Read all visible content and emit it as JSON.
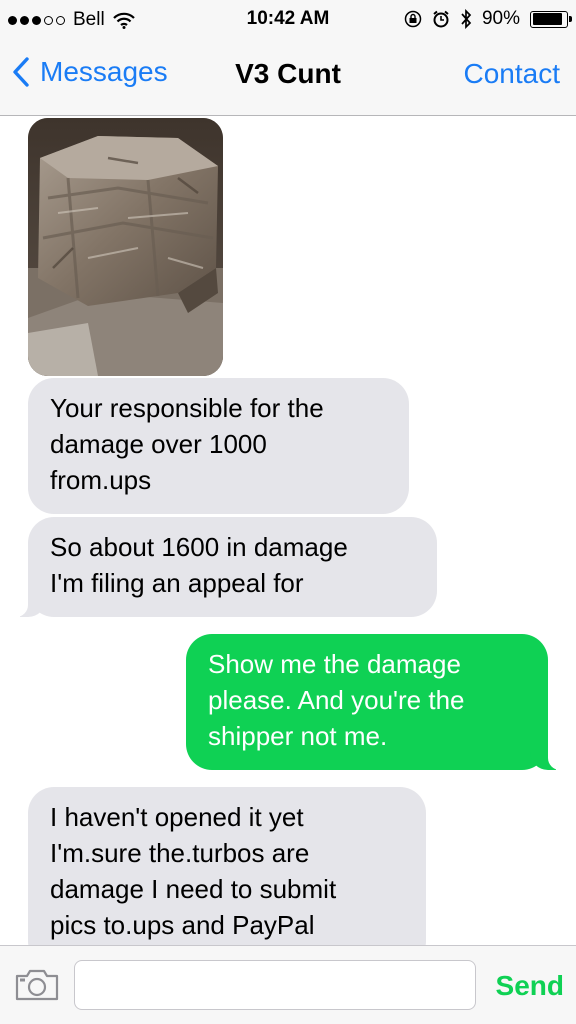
{
  "status_bar": {
    "carrier": "Bell",
    "time": "10:42 AM",
    "battery_percent": "90%",
    "battery_level": 0.9,
    "icons": [
      "signal-dots-icon",
      "wifi-icon",
      "orientation-lock-icon",
      "alarm-icon",
      "bluetooth-icon",
      "battery-icon"
    ]
  },
  "nav": {
    "back_label": "Messages",
    "title": "V3 Cunt",
    "contact_label": "Contact"
  },
  "messages": [
    {
      "direction": "incoming",
      "type": "image"
    },
    {
      "direction": "incoming",
      "lines": [
        "Your responsible for the",
        "damage over 1000",
        "from.ups"
      ]
    },
    {
      "direction": "incoming",
      "lines": [
        "So about 1600 in damage",
        "I'm filing an appeal for"
      ]
    },
    {
      "direction": "outgoing",
      "lines": [
        "Show me the damage",
        "please. And you're the",
        "shipper not me."
      ]
    },
    {
      "direction": "incoming",
      "lines": [
        "I haven't opened it yet",
        "I'm.sure the.turbos are",
        "damage I need to submit",
        "pics to.ups and PayPal"
      ]
    }
  ],
  "input": {
    "placeholder": "",
    "send_label": "Send"
  },
  "colors": {
    "ios_blue": "#1a7cf5",
    "imessage_green": "#0fd154",
    "incoming_gray": "#e5e5ea"
  }
}
